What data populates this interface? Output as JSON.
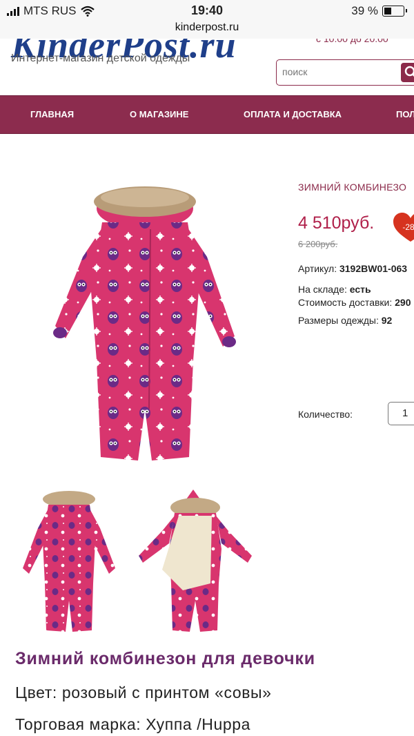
{
  "status_bar": {
    "carrier": "MTS RUS",
    "time": "19:40",
    "battery": "39 %",
    "battery_level": 0.39
  },
  "address_bar": {
    "url": "kinderpost.ru"
  },
  "header": {
    "logo_text": "KinderPost.ru",
    "tagline": "Интернет-магазин детской одежды",
    "hours": "с 10:00 до 20:00",
    "search_placeholder": "поиск"
  },
  "nav": {
    "items": [
      "ГЛАВНАЯ",
      "О МАГАЗИНЕ",
      "ОПЛАТА И ДОСТАВКА",
      "ПОЛ"
    ]
  },
  "product": {
    "title": "ЗИМНИЙ КОМБИНЕЗО",
    "price": "4 510руб.",
    "old_price": "6 200руб.",
    "discount_badge": "-28",
    "sku_label": "Артикул:",
    "sku_value": "3192BW01-063",
    "stock_label": "На складе:",
    "stock_value": "есть",
    "delivery_label": "Стоимость доставки:",
    "delivery_value": "290",
    "sizes_label": "Размеры одежды:",
    "sizes_value": "92",
    "quantity_label": "Количество:",
    "quantity_value": "1"
  },
  "description": {
    "title": "Зимний комбинезон для девочки",
    "color": "Цвет: розовый с принтом «совы»",
    "brand": "Торговая марка: Хуппа /Huppa"
  },
  "colors": {
    "brand": "#8c2c4e",
    "price": "#b0204a",
    "suit_pink": "#d8356e",
    "owl_purple": "#6b2a86"
  }
}
